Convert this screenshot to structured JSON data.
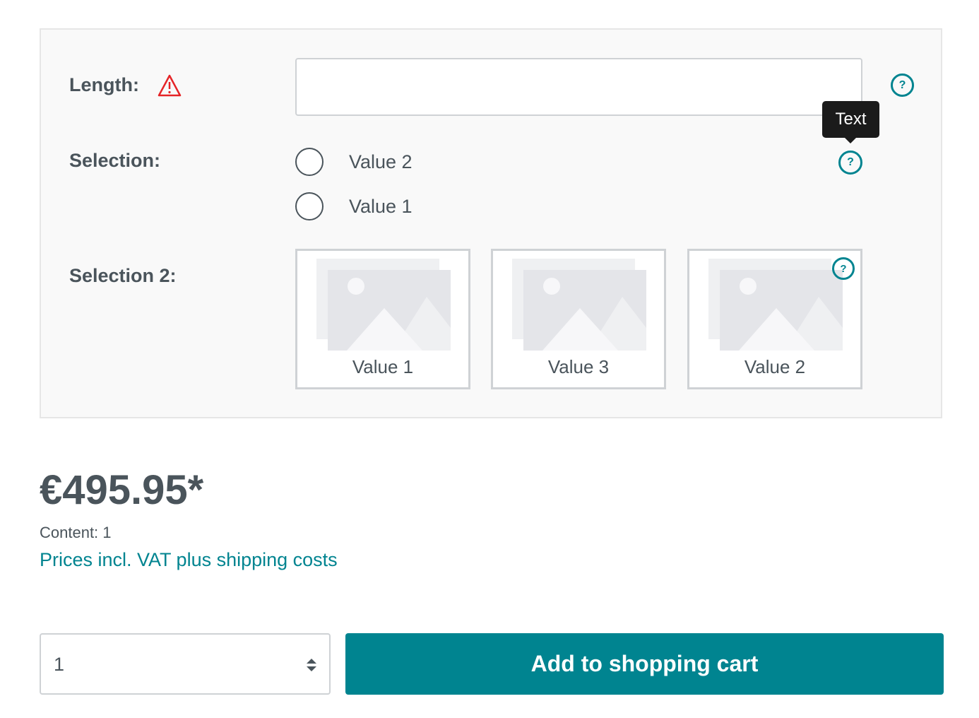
{
  "configurator": {
    "length": {
      "label": "Length:",
      "value": "",
      "placeholder": ""
    },
    "selection": {
      "label": "Selection:",
      "options": [
        {
          "label": "Value 2"
        },
        {
          "label": "Value 1"
        }
      ]
    },
    "selection2": {
      "label": "Selection 2:",
      "options": [
        {
          "label": "Value 1"
        },
        {
          "label": "Value 3"
        },
        {
          "label": "Value 2"
        }
      ]
    },
    "tooltip": {
      "text": "Text"
    },
    "help_glyph": "?"
  },
  "price": {
    "amount": "€495.95*",
    "content": "Content: 1",
    "vat_link": "Prices incl. VAT plus shipping costs"
  },
  "buy": {
    "quantity": "1",
    "cart_button": "Add to shopping cart"
  },
  "colors": {
    "accent": "#008490",
    "warning": "#e52427",
    "text": "#4a545b",
    "panel_bg": "#f9f9f9",
    "tooltip_bg": "#1b1b1b"
  },
  "icons": [
    "warning-icon",
    "help-icon",
    "image-placeholder-icon",
    "sort-arrows-icon"
  ]
}
